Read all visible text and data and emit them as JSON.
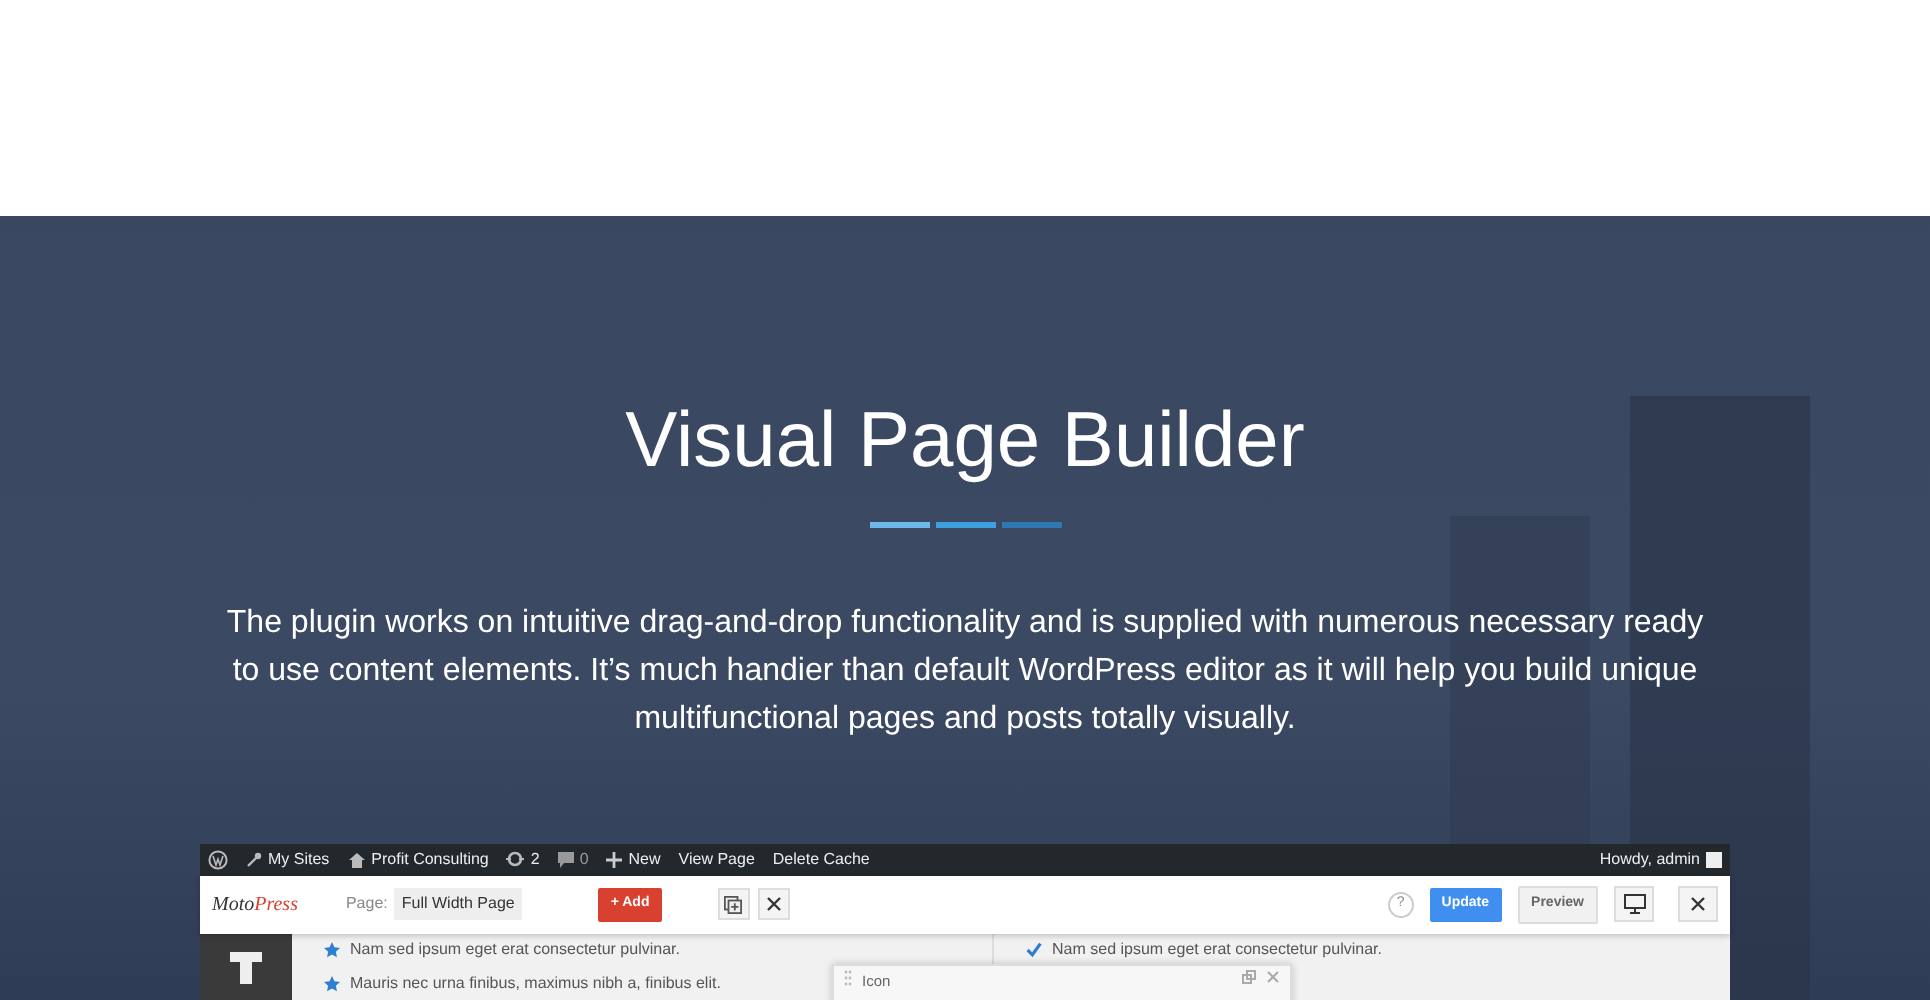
{
  "hero": {
    "title": "Visual Page Builder",
    "text": "The plugin works on intuitive drag-and-drop functionality and is supplied with numerous necessary ready to use content elements. It’s much handier than default WordPress editor as it will help you build unique multifunctional pages and posts totally visually."
  },
  "admin_bar": {
    "items": [
      {
        "kind": "logo"
      },
      {
        "kind": "key",
        "label": "My Sites"
      },
      {
        "kind": "home",
        "label": "Profit Consulting"
      },
      {
        "kind": "refresh",
        "label": "2"
      },
      {
        "kind": "comment",
        "label": "0"
      },
      {
        "kind": "plus",
        "label": "New"
      },
      {
        "kind": "text",
        "label": "View Page"
      },
      {
        "kind": "text",
        "label": "Delete Cache"
      }
    ],
    "greeting": "Howdy, admin"
  },
  "toolbar": {
    "logo": [
      "Moto",
      "Press"
    ],
    "page_label": "Page:",
    "page_value": "Full Width Page",
    "add_button": "+ Add",
    "help": "?",
    "update_button": "Update",
    "preview_button": "Preview"
  },
  "content": {
    "left": [
      {
        "kind": "star",
        "text": "Nam sed ipsum eget erat consectetur pulvinar."
      },
      {
        "kind": "star",
        "text": "Mauris nec urna finibus, maximus nibh a, finibus elit."
      }
    ],
    "right": [
      {
        "kind": "check",
        "text": "Nam sed ipsum eget erat consectetur pulvinar."
      }
    ],
    "panel_title": "Icon"
  }
}
